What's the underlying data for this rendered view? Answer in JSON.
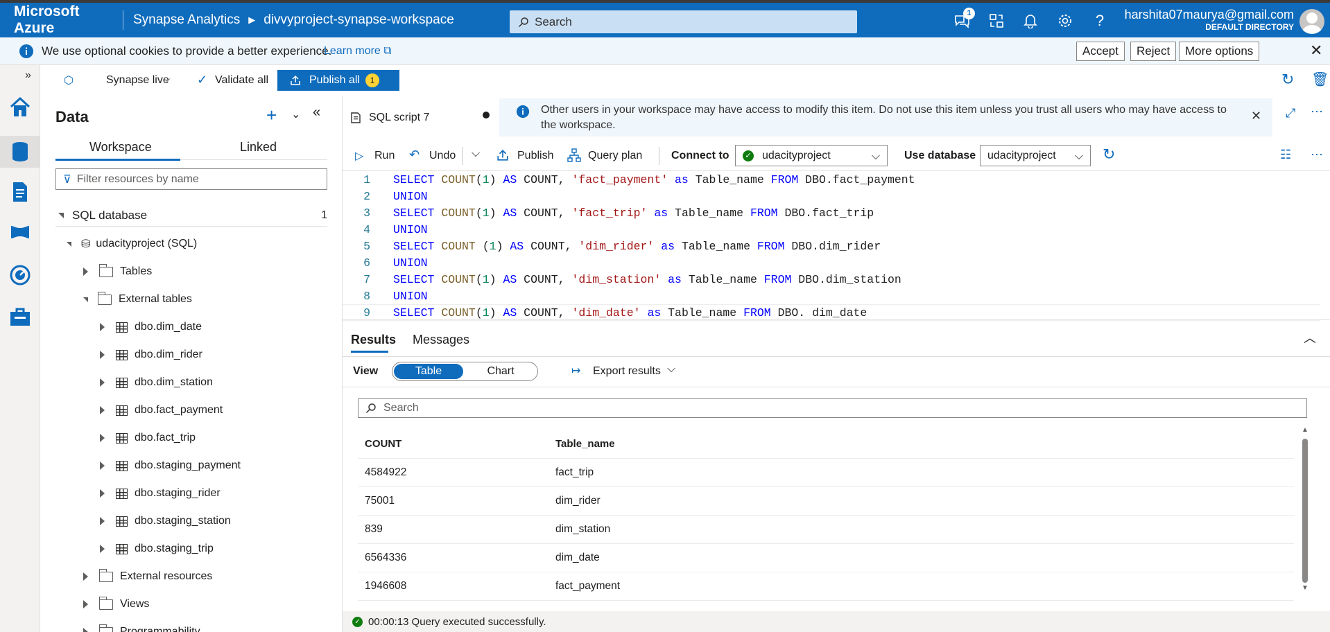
{
  "topbar": {
    "brand": "Microsoft Azure",
    "crumb1": "Synapse Analytics",
    "crumb2": "divvyproject-synapse-workspace",
    "search_placeholder": "Search",
    "notification_count": "1",
    "user_email": "harshita07maurya@gmail.com",
    "user_directory": "DEFAULT DIRECTORY"
  },
  "cookie": {
    "text": "We use optional cookies to provide a better experience.",
    "learn_more": "Learn more",
    "accept": "Accept",
    "reject": "Reject",
    "more_options": "More options"
  },
  "toolbar": {
    "synapse_live": "Synapse live",
    "validate_all": "Validate all",
    "publish_all": "Publish all",
    "publish_count": "1"
  },
  "data_panel": {
    "title": "Data",
    "tabs": [
      "Workspace",
      "Linked"
    ],
    "filter_placeholder": "Filter resources by name",
    "section": "SQL database",
    "section_count": "1",
    "db": "udacityproject (SQL)",
    "tables": "Tables",
    "external_tables": "External tables",
    "ext_items": [
      "dbo.dim_date",
      "dbo.dim_rider",
      "dbo.dim_station",
      "dbo.fact_payment",
      "dbo.fact_trip",
      "dbo.staging_payment",
      "dbo.staging_rider",
      "dbo.staging_station",
      "dbo.staging_trip"
    ],
    "external_resources": "External resources",
    "views": "Views",
    "programmability": "Programmability"
  },
  "editor": {
    "tab_title": "SQL script 7",
    "info": "Other users in your workspace may have access to modify this item. Do not use this item unless you trust all users who may have access to the workspace.",
    "run": "Run",
    "undo": "Undo",
    "publish": "Publish",
    "query_plan": "Query plan",
    "connect_to_label": "Connect to",
    "connect_to_value": "udacityproject",
    "use_db_label": "Use database",
    "use_db_value": "udacityproject",
    "lines": [
      "1",
      "2",
      "3",
      "4",
      "5",
      "6",
      "7",
      "8",
      "9"
    ]
  },
  "results": {
    "tab_results": "Results",
    "tab_messages": "Messages",
    "view_label": "View",
    "view_table": "Table",
    "view_chart": "Chart",
    "export": "Export results",
    "search_placeholder": "Search",
    "col1": "COUNT",
    "col2": "Table_name",
    "rows": [
      [
        "4584922",
        "fact_trip"
      ],
      [
        "75001",
        "dim_rider"
      ],
      [
        "839",
        "dim_station"
      ],
      [
        "6564336",
        "dim_date"
      ],
      [
        "1946608",
        "fact_payment"
      ]
    ],
    "status": "00:00:13 Query executed successfully."
  },
  "colors": {
    "accent": "#0f6cbd",
    "keyword": "#0000ff",
    "string": "#a31515",
    "number": "#098658"
  }
}
